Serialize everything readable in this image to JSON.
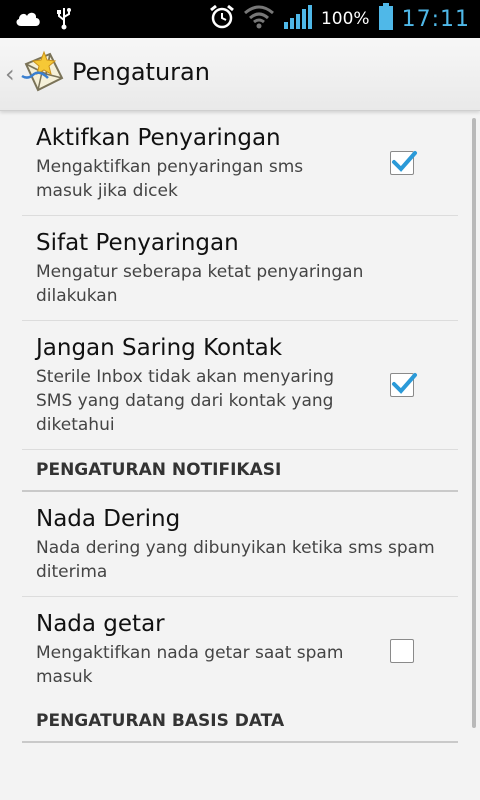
{
  "status_bar": {
    "battery": "100%",
    "time": "17:11",
    "icons": [
      "cloud-icon",
      "usb-icon",
      "alarm-icon",
      "wifi-icon",
      "signal-icon",
      "battery-icon"
    ]
  },
  "action_bar": {
    "title": "Pengaturan",
    "icons": [
      "back-chevron-icon",
      "app-envelope-icon"
    ]
  },
  "preferences": {
    "filter_enable": {
      "title": "Aktifkan Penyaringan",
      "summary": "Mengaktifkan penyaringan sms masuk jika dicek",
      "checked": true
    },
    "filter_mode": {
      "title": "Sifat Penyaringan",
      "summary": "Mengatur seberapa ketat penyaringan dilakukan"
    },
    "skip_contacts": {
      "title": "Jangan Saring Kontak",
      "summary": "Sterile Inbox tidak akan menyaring SMS yang datang dari kontak yang diketahui",
      "checked": true
    },
    "notif_category": "PENGATURAN NOTIFIKASI",
    "ringtone": {
      "title": "Nada Dering",
      "summary": "Nada dering yang dibunyikan ketika sms spam diterima"
    },
    "vibrate": {
      "title": "Nada getar",
      "summary": "Mengaktifkan nada getar saat spam masuk",
      "checked": false
    },
    "db_category": "PENGATURAN BASIS DATA"
  },
  "colors": {
    "accent": "#2b9ad8",
    "time": "#4fb8e8"
  }
}
